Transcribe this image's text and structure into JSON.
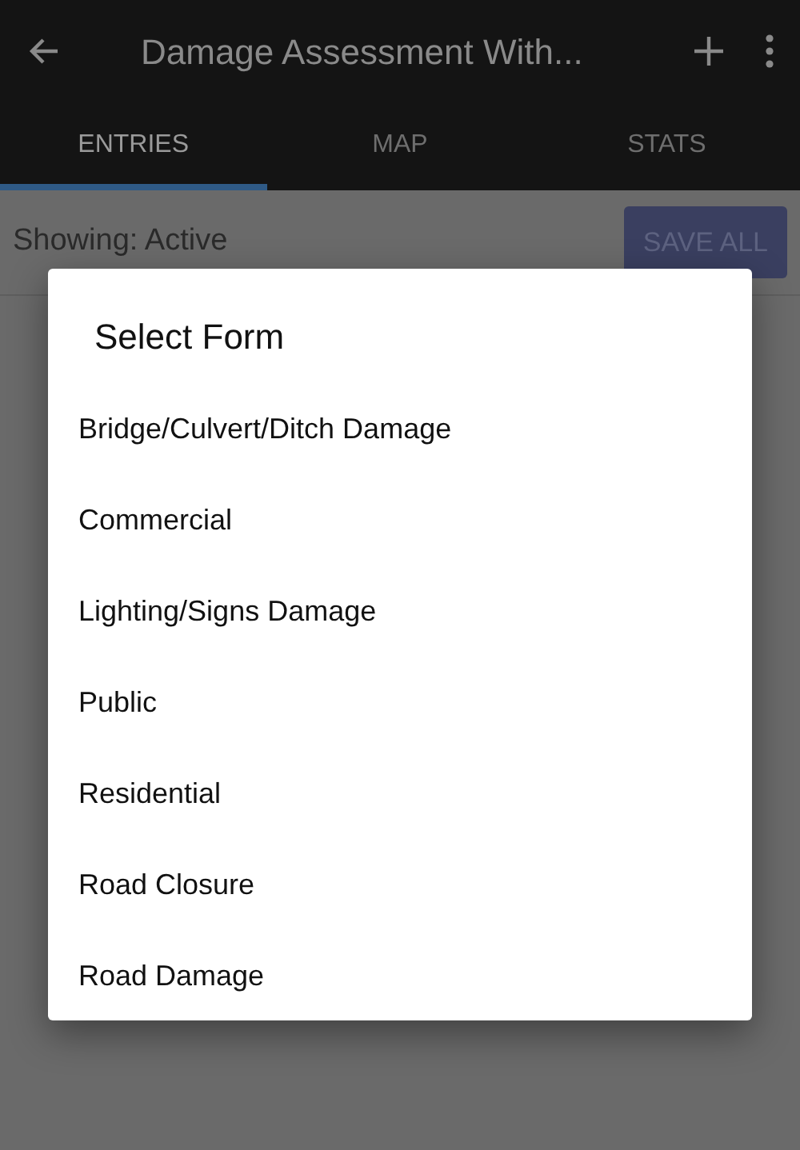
{
  "app_bar": {
    "title": "Damage Assessment With..."
  },
  "tabs": [
    {
      "label": "ENTRIES",
      "selected": true
    },
    {
      "label": "MAP",
      "selected": false
    },
    {
      "label": "STATS",
      "selected": false
    }
  ],
  "filter_bar": {
    "label": "Showing: Active",
    "button": "SAVE ALL"
  },
  "dialog": {
    "title": "Select Form",
    "items": [
      "Bridge/Culvert/Ditch Damage",
      "Commercial",
      "Lighting/Signs Damage",
      "Public",
      "Residential",
      "Road Closure",
      "Road Damage"
    ]
  }
}
